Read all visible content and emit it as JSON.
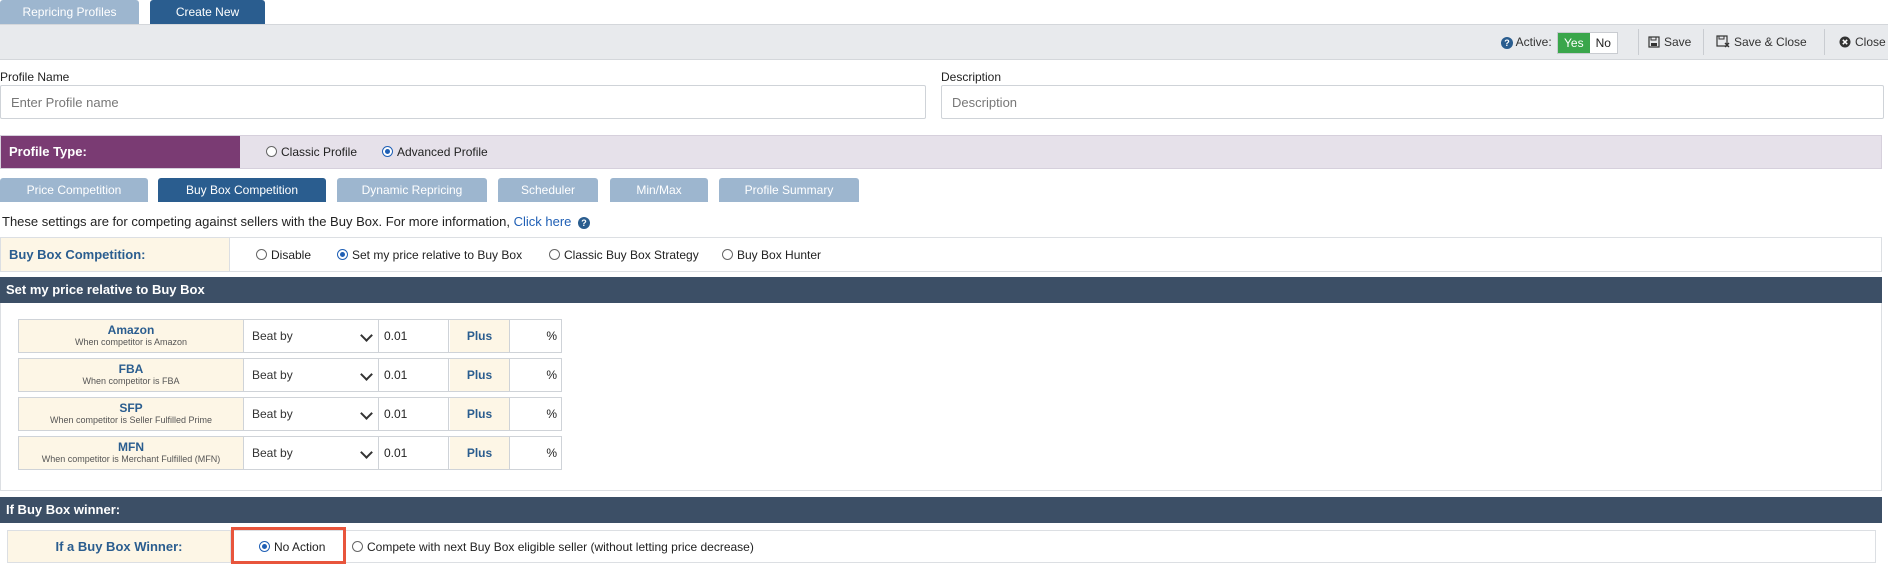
{
  "top_tabs": [
    {
      "label": "Repricing Profiles",
      "active": false
    },
    {
      "label": "Create New",
      "active": true
    }
  ],
  "toolbar": {
    "active_label": "Active:",
    "yes_label": "Yes",
    "no_label": "No",
    "save_label": "Save",
    "save_close_label": "Save & Close",
    "close_label": "Close"
  },
  "profile_name": {
    "label": "Profile Name",
    "placeholder": "Enter Profile name",
    "value": ""
  },
  "description": {
    "label": "Description",
    "placeholder": "Description",
    "value": ""
  },
  "profile_type": {
    "label": "Profile Type:",
    "options": [
      {
        "label": "Classic Profile",
        "checked": false
      },
      {
        "label": "Advanced Profile",
        "checked": true
      }
    ]
  },
  "sub_tabs": [
    {
      "label": "Price Competition",
      "active": false
    },
    {
      "label": "Buy Box Competition",
      "active": true
    },
    {
      "label": "Dynamic Repricing",
      "active": false
    },
    {
      "label": "Scheduler",
      "active": false
    },
    {
      "label": "Min/Max",
      "active": false
    },
    {
      "label": "Profile Summary",
      "active": false
    }
  ],
  "info": {
    "text": "These settings are for competing against sellers with the Buy Box. For more information,",
    "link": "Click here"
  },
  "buy_box_competition": {
    "label": "Buy Box Competition:",
    "options": [
      {
        "label": "Disable",
        "checked": false
      },
      {
        "label": "Set my price relative to Buy Box",
        "checked": true
      },
      {
        "label": "Classic Buy Box Strategy",
        "checked": false
      },
      {
        "label": "Buy Box Hunter",
        "checked": false
      }
    ]
  },
  "relative_section": {
    "title": "Set my price relative to Buy Box",
    "rows": [
      {
        "name": "Amazon",
        "sub": "When competitor is Amazon",
        "action": "Beat by",
        "value": "0.01",
        "plus": "Plus",
        "unit": "%"
      },
      {
        "name": "FBA",
        "sub": "When competitor is FBA",
        "action": "Beat by",
        "value": "0.01",
        "plus": "Plus",
        "unit": "%"
      },
      {
        "name": "SFP",
        "sub": "When competitor is Seller Fulfilled Prime",
        "action": "Beat by",
        "value": "0.01",
        "plus": "Plus",
        "unit": "%"
      },
      {
        "name": "MFN",
        "sub": "When competitor is Merchant Fulfilled (MFN)",
        "action": "Beat by",
        "value": "0.01",
        "plus": "Plus",
        "unit": "%"
      }
    ]
  },
  "winner_section": {
    "title": "If Buy Box winner:",
    "label": "If a Buy Box Winner:",
    "options": [
      {
        "label": "No Action",
        "checked": true
      },
      {
        "label": "Compete with next Buy Box eligible seller (without letting price decrease)",
        "checked": false
      }
    ]
  },
  "colors": {
    "accent": "#2a5d8f",
    "profile_type": "#7a3b73",
    "section_head": "#3c4f66",
    "highlight": "#e8553c",
    "active_yes": "#3aa64b"
  }
}
